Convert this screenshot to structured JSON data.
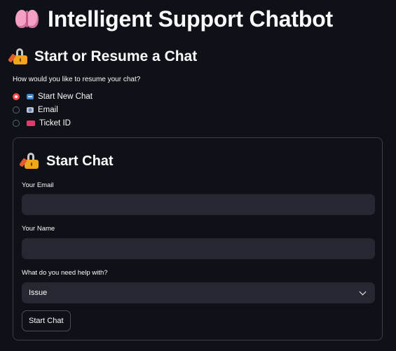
{
  "app": {
    "title": "Intelligent Support Chatbot",
    "title_icon": "brain-icon"
  },
  "resume_section": {
    "heading": "Start or Resume a Chat",
    "heading_icon": "locked-with-pen-icon",
    "question": "How would you like to resume your chat?",
    "options": [
      {
        "label": "Start New Chat",
        "icon": "new-button-icon",
        "selected": true
      },
      {
        "label": "Email",
        "icon": "email-icon",
        "selected": false
      },
      {
        "label": "Ticket ID",
        "icon": "ticket-icon",
        "selected": false
      }
    ]
  },
  "start_chat": {
    "heading": "Start Chat",
    "heading_icon": "locked-with-pen-icon",
    "email_label": "Your Email",
    "email_value": "",
    "name_label": "Your Name",
    "name_value": "",
    "help_label": "What do you need help with?",
    "help_selected": "Issue",
    "submit_label": "Start Chat"
  },
  "colors": {
    "background": "#0e1117",
    "input_background": "#262730",
    "accent": "#ff4b4b",
    "border": "#3b3e48"
  }
}
